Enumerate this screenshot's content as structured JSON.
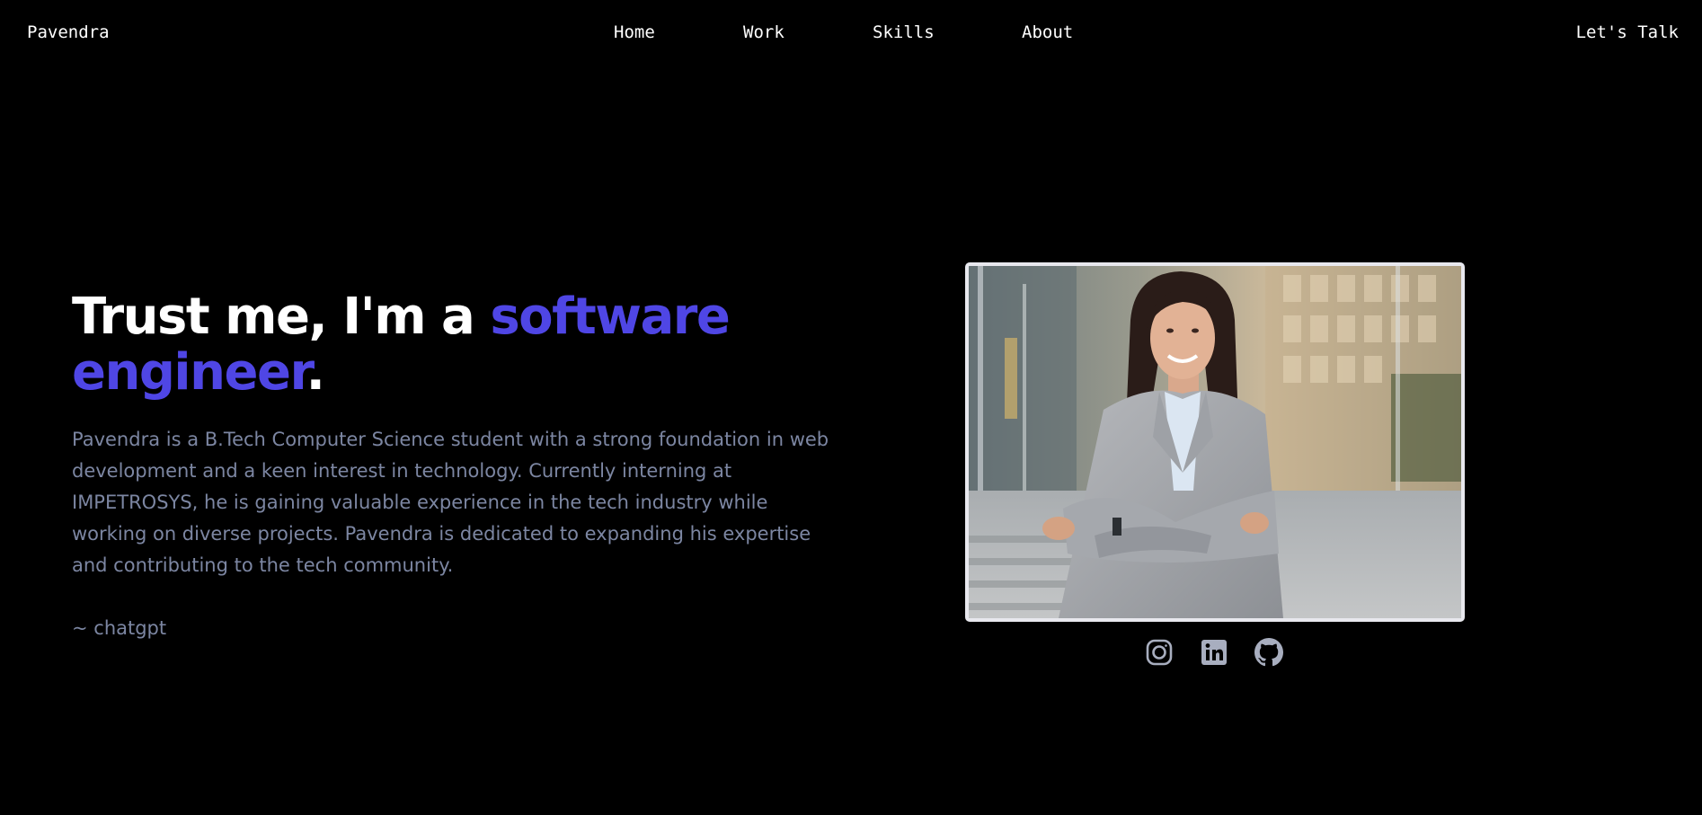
{
  "nav": {
    "brand": "Pavendra",
    "links": [
      {
        "label": "Home"
      },
      {
        "label": "Work"
      },
      {
        "label": "Skills"
      },
      {
        "label": "About"
      }
    ],
    "cta": "Let's Talk"
  },
  "hero": {
    "title_part1": "Trust me, I'm a ",
    "title_accent1": "software",
    "title_accent2": "engineer",
    "title_end": ".",
    "description": "Pavendra is a B.Tech Computer Science student with a strong foundation in web development and a keen interest in technology. Currently interning at IMPETROSYS, he is gaining valuable experience in the tech industry while working on diverse projects. Pavendra is dedicated to expanding his expertise and contributing to the tech community.",
    "quote": "~ chatgpt"
  },
  "photo": {
    "icon": "portrait-photo"
  },
  "socials": [
    {
      "icon": "instagram-icon"
    },
    {
      "icon": "linkedin-icon"
    },
    {
      "icon": "github-icon"
    }
  ],
  "colors": {
    "background": "#000000",
    "accent": "#4f46e5",
    "text_muted": "#7c86a2",
    "icon_color": "#a8aebf"
  }
}
